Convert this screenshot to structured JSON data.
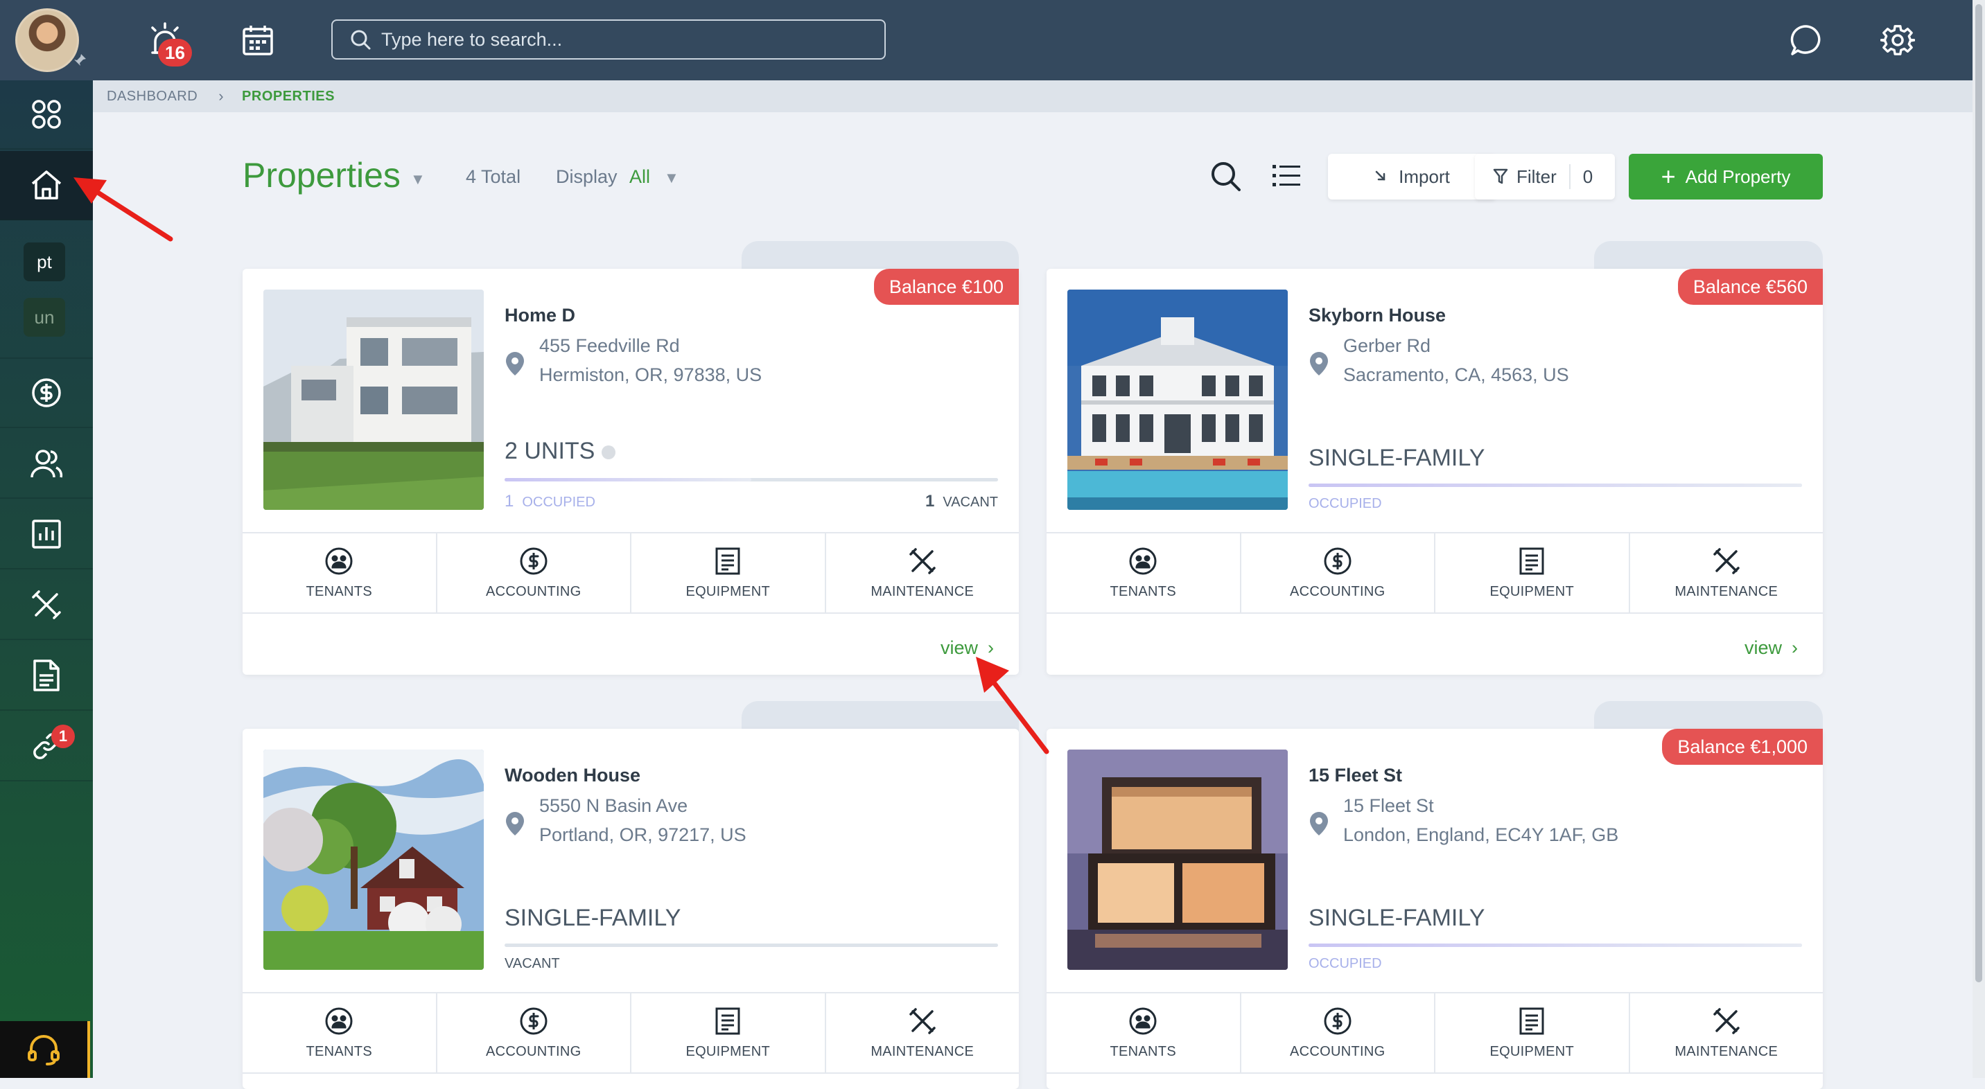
{
  "topbar": {
    "notification_count": "16",
    "search_placeholder": "Type here to search..."
  },
  "sidebar": {
    "chip_pt": "pt",
    "chip_un": "un",
    "links_badge": "1"
  },
  "breadcrumb": {
    "items": [
      "DASHBOARD",
      "PROPERTIES"
    ]
  },
  "header": {
    "title": "Properties",
    "total": "4 Total",
    "display_label": "Display",
    "display_value": "All",
    "import_label": "Import",
    "filter_label": "Filter",
    "filter_count": "0",
    "add_label": "Add Property"
  },
  "actions": {
    "tenants": "TENANTS",
    "accounting": "ACCOUNTING",
    "equipment": "EQUIPMENT",
    "maintenance": "MAINTENANCE",
    "view": "view"
  },
  "properties": [
    {
      "name": "Home D",
      "address_1": "455 Feedville Rd",
      "address_2": "Hermiston, OR, 97838, US",
      "balance": "Balance €100",
      "units": "2 UNITS",
      "occupied_count": "1",
      "occupied_label": "OCCUPIED",
      "vacant_count": "1",
      "vacant_label": "VACANT",
      "occupancy_fraction": 0.5
    },
    {
      "name": "Skyborn House",
      "address_1": "Gerber Rd",
      "address_2": "Sacramento, CA, 4563, US",
      "balance": "Balance €560",
      "type": "SINGLE-FAMILY",
      "status": "OCCUPIED",
      "occupancy_fraction": 1
    },
    {
      "name": "Wooden House",
      "address_1": "5550 N Basin Ave",
      "address_2": "Portland, OR, 97217, US",
      "type": "SINGLE-FAMILY",
      "status": "VACANT",
      "occupancy_fraction": 0
    },
    {
      "name": "15 Fleet St",
      "address_1": "15 Fleet St",
      "address_2": "London, England, EC4Y 1AF, GB",
      "balance": "Balance €1,000",
      "type": "SINGLE-FAMILY",
      "status": "OCCUPIED",
      "occupancy_fraction": 1
    }
  ],
  "colors": {
    "brand_green": "#3d9a3d",
    "balance_red": "#e55353",
    "topbar": "#34495e"
  }
}
